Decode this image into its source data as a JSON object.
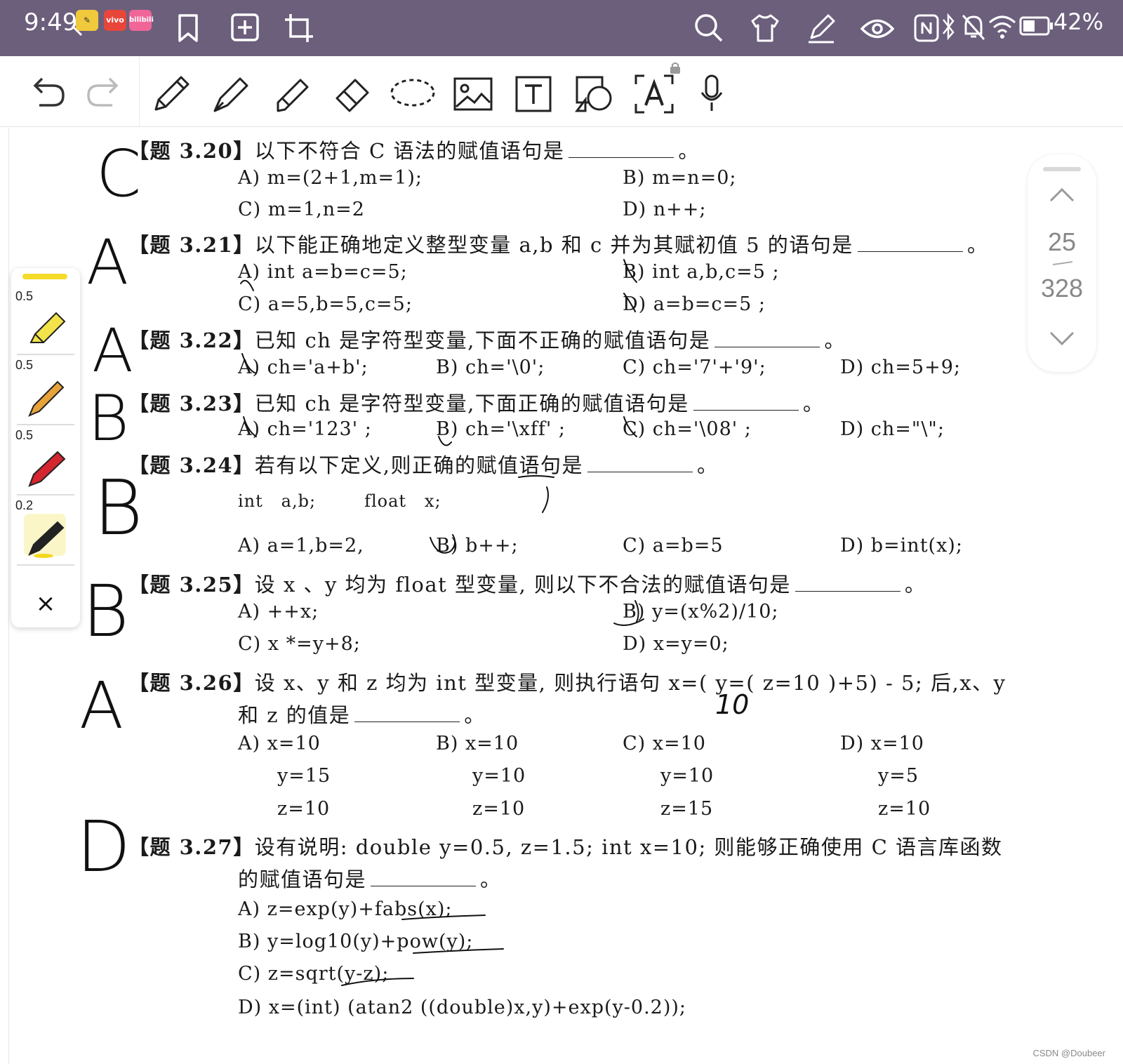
{
  "status_bar": {
    "time": "9:49",
    "battery_percent": "42%",
    "app_badges": [
      "vivo",
      "bilibili"
    ]
  },
  "toolbar": {
    "tools": [
      "undo-icon",
      "redo-icon",
      "pen-icon",
      "fountain-pen-icon",
      "highlighter-icon",
      "eraser-icon",
      "lasso-icon",
      "image-icon",
      "text-box-icon",
      "shape-icon",
      "text-recognition-icon",
      "microphone-icon"
    ]
  },
  "questions": [
    {
      "number": "【题 3.20】",
      "stem": "以下不符合 C 语法的赋值语句是",
      "end": "。",
      "options": [
        "A) m=(2+1,m=1);",
        "B) m=n=0;",
        "C) m=1,n=2",
        "D) n++;"
      ],
      "handwritten_answer": "C"
    },
    {
      "number": "【题 3.21】",
      "stem": "以下能正确地定义整型变量 a,b 和 c 并为其赋初值 5 的语句是",
      "end": "。",
      "options": [
        "A) int a=b=c=5;",
        "B) int a,b,c=5 ;",
        "C) a=5,b=5,c=5;",
        "D) a=b=c=5 ;"
      ],
      "handwritten_answer": "A"
    },
    {
      "number": "【题 3.22】",
      "stem": "已知 ch 是字符型变量,下面不正确的赋值语句是",
      "end": "。",
      "options": [
        "A) ch='a+b';",
        "B) ch='\\0';",
        "C) ch='7'+'9';",
        "D) ch=5+9;"
      ],
      "handwritten_answer": "A"
    },
    {
      "number": "【题 3.23】",
      "stem": "已知 ch 是字符型变量,下面正确的赋值语句是",
      "end": "。",
      "options": [
        "A) ch='123' ;",
        "B) ch='\\xff' ;",
        "C) ch='\\08' ;",
        "D) ch=\"\\\";"
      ],
      "handwritten_answer": "B"
    },
    {
      "number": "【题 3.24】",
      "stem": "若有以下定义,则正确的赋值语句是",
      "end": "。",
      "code": "int   a,b;        float   x;",
      "options": [
        "A) a=1,b=2,",
        "B) b++;",
        "C) a=b=5",
        "D) b=int(x);"
      ],
      "handwritten_answer": "B"
    },
    {
      "number": "【题 3.25】",
      "stem": "设 x 、y 均为 float 型变量, 则以下不合法的赋值语句是",
      "end": "。",
      "options": [
        "A) ++x;",
        "B) y=(x%2)/10;",
        "C) x *=y+8;",
        "D) x=y=0;"
      ],
      "handwritten_answer": "B"
    },
    {
      "number": "【题 3.26】",
      "stem": "设 x、y 和 z 均为 int 型变量, 则执行语句 x=( y=( z=10 )+5) - 5; 后,x、y",
      "stem2": "和 z 的值是",
      "end": "。",
      "options": [
        {
          "label": "A) x=10",
          "y": "y=15",
          "z": "z=10"
        },
        {
          "label": "B) x=10",
          "y": "y=10",
          "z": "z=10"
        },
        {
          "label": "C) x=10",
          "y": "y=10",
          "z": "z=15"
        },
        {
          "label": "D) x=10",
          "y": "y=5",
          "z": "z=10"
        }
      ],
      "handwritten_answer": "A",
      "handwritten_note": "10"
    },
    {
      "number": "【题 3.27】",
      "stem": "设有说明: double y=0.5, z=1.5; int x=10; 则能够正确使用 C 语言库函数",
      "stem2": "的赋值语句是",
      "end": "。",
      "options": [
        "A) z=exp(y)+fabs(x);",
        "B) y=log10(y)+pow(y);",
        "C) z=sqrt(y-z);",
        "D) x=(int) (atan2 ((double)x,y)+exp(y-0.2));"
      ],
      "handwritten_answer": "D"
    }
  ],
  "pen_palette": {
    "pens": [
      {
        "size": "0.5",
        "name": "yellow-highlighter",
        "color": "#f2e34a"
      },
      {
        "size": "0.5",
        "name": "orange-pen",
        "color": "#e8a23a"
      },
      {
        "size": "0.5",
        "name": "red-pen",
        "color": "#d3262e"
      },
      {
        "size": "0.2",
        "name": "black-pen",
        "color": "#222222"
      }
    ],
    "active_color": "#f6dc2a",
    "close_label": "×"
  },
  "page_nav": {
    "current": "25",
    "total": "328"
  },
  "watermark": "CSDN @Doubeer"
}
